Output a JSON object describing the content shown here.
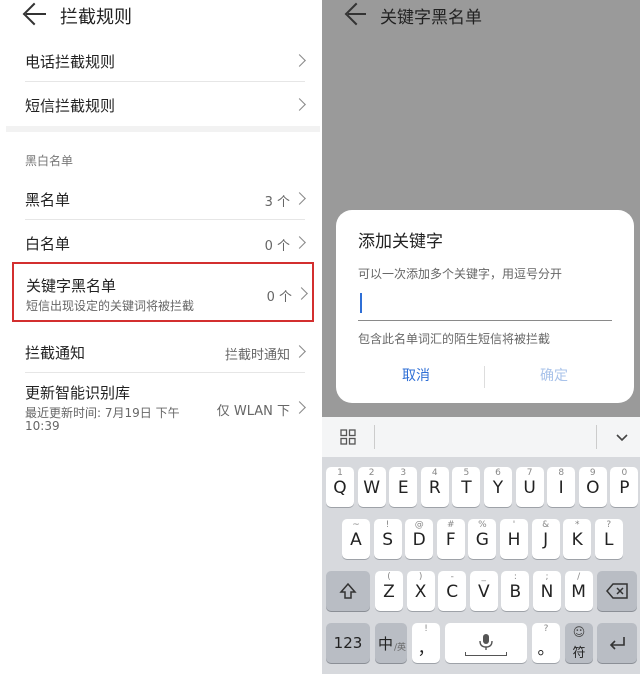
{
  "left": {
    "title": "拦截规则",
    "rows_group1": [
      {
        "label": "电话拦截规则"
      },
      {
        "label": "短信拦截规则"
      }
    ],
    "section_header": "黑白名单",
    "blacklist": {
      "label": "黑名单",
      "value": "3 个"
    },
    "whitelist": {
      "label": "白名单",
      "value": "0 个"
    },
    "keyword_blacklist": {
      "label": "关键字黑名单",
      "subtitle": "短信出现设定的关键词将被拦截",
      "value": "0 个"
    },
    "intercept_notice": {
      "label": "拦截通知",
      "value": "拦截时通知"
    },
    "update_lib": {
      "label": "更新智能识别库",
      "subtitle_line1": "最近更新时间: 7月19日 下午",
      "subtitle_line2": "10:39",
      "value": "仅 WLAN 下"
    },
    "highlight_color": "#d32f2f"
  },
  "right": {
    "title": "关键字黑名单",
    "dialog": {
      "title": "添加关键字",
      "hint": "可以一次添加多个关键字，用逗号分开",
      "input_value": "",
      "note": "包含此名单词汇的陌生短信将被拦截",
      "cancel": "取消",
      "confirm": "确定",
      "accent": "#2f6fd6",
      "disabled": "#a9c3ea"
    },
    "keyboard": {
      "row1": [
        {
          "k": "Q",
          "s": "1"
        },
        {
          "k": "W",
          "s": "2"
        },
        {
          "k": "E",
          "s": "3"
        },
        {
          "k": "R",
          "s": "4"
        },
        {
          "k": "T",
          "s": "5"
        },
        {
          "k": "Y",
          "s": "6"
        },
        {
          "k": "U",
          "s": "7"
        },
        {
          "k": "I",
          "s": "8"
        },
        {
          "k": "O",
          "s": "9"
        },
        {
          "k": "P",
          "s": "0"
        }
      ],
      "row2": [
        {
          "k": "A",
          "s": "~"
        },
        {
          "k": "S",
          "s": "!"
        },
        {
          "k": "D",
          "s": "@"
        },
        {
          "k": "F",
          "s": "#"
        },
        {
          "k": "G",
          "s": "%"
        },
        {
          "k": "H",
          "s": "'"
        },
        {
          "k": "J",
          "s": "&"
        },
        {
          "k": "K",
          "s": "*"
        },
        {
          "k": "L",
          "s": "?"
        }
      ],
      "row3": [
        {
          "k": "Z",
          "s": "("
        },
        {
          "k": "X",
          "s": ")"
        },
        {
          "k": "C",
          "s": "-"
        },
        {
          "k": "V",
          "s": "_"
        },
        {
          "k": "B",
          "s": ":"
        },
        {
          "k": "N",
          "s": ";"
        },
        {
          "k": "M",
          "s": "/"
        }
      ],
      "num_key": "123",
      "lang_key_main": "中",
      "lang_key_sub": "/英",
      "comma_key": "，",
      "comma_sub": "!",
      "period_key": "。",
      "period_sub": "?",
      "symbol_key": "符",
      "icons": [
        "grid-icon",
        "chevron-down-icon",
        "shift-icon",
        "backspace-icon",
        "mic-icon",
        "emoji-icon",
        "enter-icon"
      ]
    }
  }
}
